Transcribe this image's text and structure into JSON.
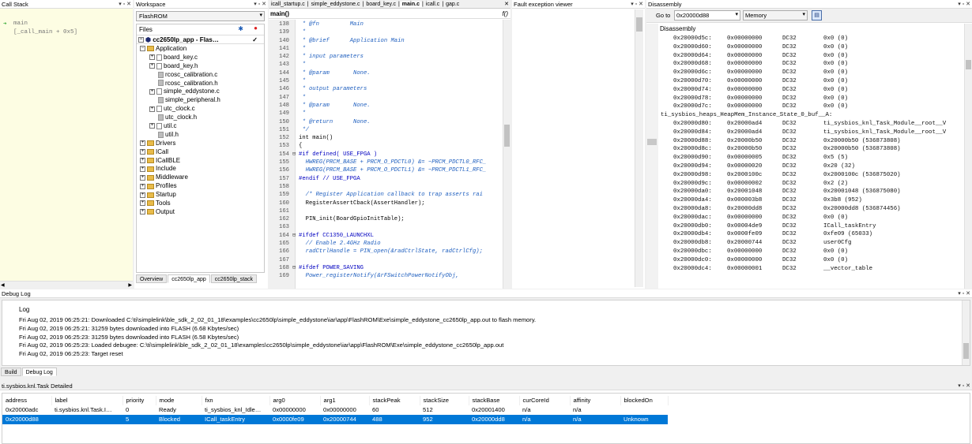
{
  "callstack": {
    "title": "Call Stack",
    "controls": "▾ ▫ ✕",
    "lines": [
      "main",
      "[_call_main + 0x5]"
    ]
  },
  "workspace": {
    "title": "Workspace",
    "controls": "▾ ▫ ✕",
    "config": "FlashROM",
    "files_label": "Files",
    "project": "cc2650lp_app - Flas…",
    "tree": [
      {
        "label": "Application",
        "kind": "folder",
        "level": 0,
        "exp": "−"
      },
      {
        "label": "board_key.c",
        "kind": "file",
        "level": 1,
        "exp": "+"
      },
      {
        "label": "board_key.h",
        "kind": "file",
        "level": 1,
        "exp": "+"
      },
      {
        "label": "rcosc_calibration.c",
        "kind": "gray",
        "level": 1,
        "exp": ""
      },
      {
        "label": "rcosc_calibration.h",
        "kind": "gray",
        "level": 1,
        "exp": ""
      },
      {
        "label": "simple_eddystone.c",
        "kind": "file",
        "level": 1,
        "exp": "+"
      },
      {
        "label": "simple_peripheral.h",
        "kind": "gray",
        "level": 1,
        "exp": ""
      },
      {
        "label": "utc_clock.c",
        "kind": "file",
        "level": 1,
        "exp": "+"
      },
      {
        "label": "utc_clock.h",
        "kind": "gray",
        "level": 1,
        "exp": ""
      },
      {
        "label": "util.c",
        "kind": "file",
        "level": 1,
        "exp": "+"
      },
      {
        "label": "util.h",
        "kind": "gray",
        "level": 1,
        "exp": ""
      },
      {
        "label": "Drivers",
        "kind": "folder",
        "level": 0,
        "exp": "+"
      },
      {
        "label": "ICall",
        "kind": "folder",
        "level": 0,
        "exp": "+"
      },
      {
        "label": "ICallBLE",
        "kind": "folder",
        "level": 0,
        "exp": "+"
      },
      {
        "label": "Include",
        "kind": "folder",
        "level": 0,
        "exp": "+"
      },
      {
        "label": "Middleware",
        "kind": "folder",
        "level": 0,
        "exp": "+"
      },
      {
        "label": "Profiles",
        "kind": "folder",
        "level": 0,
        "exp": "+"
      },
      {
        "label": "Startup",
        "kind": "folder",
        "level": 0,
        "exp": "+"
      },
      {
        "label": "Tools",
        "kind": "folder",
        "level": 0,
        "exp": "+"
      },
      {
        "label": "Output",
        "kind": "folder",
        "level": 0,
        "exp": "+"
      }
    ],
    "bottom_tabs": [
      "Overview",
      "cc2650lp_app",
      "cc2650lp_stack"
    ]
  },
  "editor": {
    "tabs": [
      "icall_startup.c",
      "simple_eddystone.c",
      "board_key.c",
      "main.c",
      "icall.c",
      "gap.c"
    ],
    "active_tab": "main.c",
    "func": "main()",
    "fx": "f()",
    "lines": [
      {
        "n": "138",
        "g": "",
        "t": " * @fn         Main",
        "c": "cmt"
      },
      {
        "n": "139",
        "g": "",
        "t": " *",
        "c": "cmt"
      },
      {
        "n": "140",
        "g": "",
        "t": " * @brief      Application Main",
        "c": "cmt"
      },
      {
        "n": "141",
        "g": "",
        "t": " *",
        "c": "cmt"
      },
      {
        "n": "142",
        "g": "",
        "t": " * input parameters",
        "c": "cmt"
      },
      {
        "n": "143",
        "g": "",
        "t": " *",
        "c": "cmt"
      },
      {
        "n": "144",
        "g": "",
        "t": " * @param       None.",
        "c": "cmt"
      },
      {
        "n": "145",
        "g": "",
        "t": " *",
        "c": "cmt"
      },
      {
        "n": "146",
        "g": "",
        "t": " * output parameters",
        "c": "cmt"
      },
      {
        "n": "147",
        "g": "",
        "t": " *",
        "c": "cmt"
      },
      {
        "n": "148",
        "g": "",
        "t": " * @param       None.",
        "c": "cmt"
      },
      {
        "n": "149",
        "g": "",
        "t": " *",
        "c": "cmt"
      },
      {
        "n": "150",
        "g": "",
        "t": " * @return      None.",
        "c": "cmt"
      },
      {
        "n": "151",
        "g": "",
        "t": " */",
        "c": "cmt"
      },
      {
        "n": "152",
        "g": "",
        "t": "int main()",
        "c": ""
      },
      {
        "n": "153",
        "g": "",
        "t": "{",
        "c": ""
      },
      {
        "n": "154",
        "g": "⊟",
        "t": "#if defined( USE_FPGA )",
        "c": "pp"
      },
      {
        "n": "155",
        "g": "",
        "t": "  HWREG(PRCM_BASE + PRCM_O_PDCTL0) &= ~PRCM_PDCTL0_RFC_",
        "c": "cmt"
      },
      {
        "n": "156",
        "g": "",
        "t": "  HWREG(PRCM_BASE + PRCM_O_PDCTL1) &= ~PRCM_PDCTL1_RFC_",
        "c": "cmt"
      },
      {
        "n": "157",
        "g": "",
        "t": "#endif // USE_FPGA",
        "c": "pp"
      },
      {
        "n": "158",
        "g": "",
        "t": "",
        "c": ""
      },
      {
        "n": "159",
        "g": "",
        "t": "  /* Register Application callback to trap asserts rai",
        "c": "cmt"
      },
      {
        "n": "160",
        "g": "",
        "t": "  RegisterAssertCback(AssertHandler);",
        "c": ""
      },
      {
        "n": "161",
        "g": "",
        "t": "",
        "c": ""
      },
      {
        "n": "162",
        "g": "",
        "t": "  PIN_init(BoardGpioInitTable);",
        "c": ""
      },
      {
        "n": "163",
        "g": "",
        "t": "",
        "c": ""
      },
      {
        "n": "164",
        "g": "⊟",
        "t": "#ifdef CC1350_LAUNCHXL",
        "c": "pp"
      },
      {
        "n": "165",
        "g": "",
        "t": "  // Enable 2.4GHz Radio",
        "c": "cmt"
      },
      {
        "n": "166",
        "g": "",
        "t": "  radCtrlHandle = PIN_open(&radCtrlState, radCtrlCfg);",
        "c": "cmt"
      },
      {
        "n": "167",
        "g": "",
        "t": "",
        "c": ""
      },
      {
        "n": "168",
        "g": "⊟",
        "t": "#ifdef POWER_SAVING",
        "c": "pp"
      },
      {
        "n": "169",
        "g": "",
        "t": "  Power_registerNotify(&rFSwitchPowerNotifyObj,",
        "c": "cmt"
      }
    ]
  },
  "fault": {
    "title": "Fault exception viewer",
    "controls": "▾ ▫ ✕"
  },
  "disasm": {
    "title": "Disassembly",
    "controls": "▾ ▫ ✕",
    "goto_label": "Go to",
    "goto_value": "0x20000d88",
    "mem_value": "Memory",
    "header": "Disassembly",
    "rows": [
      [
        "0x20000d5c:",
        "0x00000000",
        "DC32",
        "0x0 (0)"
      ],
      [
        "0x20000d60:",
        "0x00000000",
        "DC32",
        "0x0 (0)"
      ],
      [
        "0x20000d64:",
        "0x00000000",
        "DC32",
        "0x0 (0)"
      ],
      [
        "0x20000d68:",
        "0x00000000",
        "DC32",
        "0x0 (0)"
      ],
      [
        "0x20000d6c:",
        "0x00000000",
        "DC32",
        "0x0 (0)"
      ],
      [
        "0x20000d70:",
        "0x00000000",
        "DC32",
        "0x0 (0)"
      ],
      [
        "0x20000d74:",
        "0x00000000",
        "DC32",
        "0x0 (0)"
      ],
      [
        "0x20000d78:",
        "0x00000000",
        "DC32",
        "0x0 (0)"
      ],
      [
        "0x20000d7c:",
        "0x00000000",
        "DC32",
        "0x0 (0)"
      ],
      [
        "LABEL",
        "ti_sysbios_heaps_HeapMem_Instance_State_0_buf__A:",
        "",
        ""
      ],
      [
        "0x20000d80:",
        "0x20000ad4",
        "DC32",
        "ti_sysbios_knl_Task_Module__root__V"
      ],
      [
        "0x20000d84:",
        "0x20000ad4",
        "DC32",
        "ti_sysbios_knl_Task_Module__root__V"
      ],
      [
        "0x20000d88:",
        "0x20000b50",
        "DC32",
        "0x20000b50 (536873808)"
      ],
      [
        "0x20000d8c:",
        "0x20000b50",
        "DC32",
        "0x20000b50 (536873808)"
      ],
      [
        "0x20000d90:",
        "0x00000005",
        "DC32",
        "0x5 (5)"
      ],
      [
        "0x20000d94:",
        "0x00000020",
        "DC32",
        "0x20 (32)"
      ],
      [
        "0x20000d98:",
        "0x2000100c",
        "DC32",
        "0x2000100c (536875020)"
      ],
      [
        "0x20000d9c:",
        "0x00000002",
        "DC32",
        "0x2 (2)"
      ],
      [
        "0x20000da0:",
        "0x20001048",
        "DC32",
        "0x20001048 (536875080)"
      ],
      [
        "0x20000da4:",
        "0x000003b8",
        "DC32",
        "0x3b8 (952)"
      ],
      [
        "0x20000da8:",
        "0x20000dd8",
        "DC32",
        "0x20000dd8 (536874456)"
      ],
      [
        "0x20000dac:",
        "0x00000000",
        "DC32",
        "0x0 (0)"
      ],
      [
        "0x20000db0:",
        "0x00004de9",
        "DC32",
        "ICall_taskEntry"
      ],
      [
        "0x20000db4:",
        "0x0000fe09",
        "DC32",
        "0xfe09 (65033)"
      ],
      [
        "0x20000db8:",
        "0x20000744",
        "DC32",
        "user0Cfg"
      ],
      [
        "0x20000dbc:",
        "0x00000000",
        "DC32",
        "0x0 (0)"
      ],
      [
        "0x20000dc0:",
        "0x00000000",
        "DC32",
        "0x0 (0)"
      ],
      [
        "0x20000dc4:",
        "0x00000001",
        "DC32",
        "__vector_table"
      ]
    ]
  },
  "debuglog": {
    "title": "Debug Log",
    "controls": "▾ ▫ ✕",
    "header": "Log",
    "lines": [
      "Fri Aug 02, 2019 06:25:21: Downloaded C:\\ti\\simplelink\\ble_sdk_2_02_01_18\\examples\\cc2650lp\\simple_eddystone\\iar\\app\\FlashROM\\Exe\\simple_eddystone_cc2650lp_app.out to flash memory.",
      "Fri Aug 02, 2019 06:25:21: 31259 bytes downloaded into FLASH (6.68 Kbytes/sec)",
      "Fri Aug 02, 2019 06:25:23: 31259 bytes downloaded into FLASH (6.58 Kbytes/sec)",
      "Fri Aug 02, 2019 06:25:23: Loaded debugee: C:\\ti\\simplelink\\ble_sdk_2_02_01_18\\examples\\cc2650lp\\simple_eddystone\\iar\\app\\FlashROM\\Exe\\simple_eddystone_cc2650lp_app.out",
      "Fri Aug 02, 2019 06:25:23: Target reset"
    ],
    "tabs": [
      "Build",
      "Debug Log"
    ]
  },
  "task": {
    "title": "ti.sysbios.knl.Task Detailed",
    "controls": "▾ ▫ ✕",
    "columns": [
      "address",
      "label",
      "priority",
      "mode",
      "fxn",
      "arg0",
      "arg1",
      "stackPeak",
      "stackSize",
      "stackBase",
      "curCoreId",
      "affinity",
      "blockedOn"
    ],
    "rows": [
      [
        "0x20000adc",
        "ti.sysbios.knl.Task.I…",
        "0",
        "Ready",
        "ti_sysbios_knl_Idle…",
        "0x00000000",
        "0x00000000",
        "60",
        "512",
        "0x20001400",
        "n/a",
        "n/a",
        ""
      ],
      [
        "0x20000d88",
        "",
        "5",
        "Blocked",
        "ICall_taskEntry",
        "0x0000fe09",
        "0x20000744",
        "488",
        "952",
        "0x20000dd8",
        "n/a",
        "n/a",
        "Unknown"
      ]
    ]
  },
  "colors": {
    "selection": "#0078d7",
    "arrow": "#2aa52a",
    "code_comment": "#1f5fbf"
  }
}
